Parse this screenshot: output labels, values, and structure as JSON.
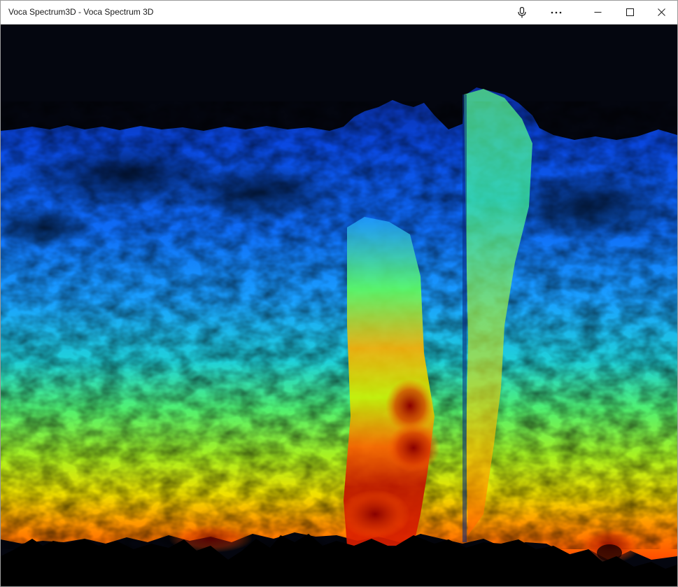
{
  "window": {
    "title": "Voca Spectrum3D - Voca Spectrum 3D"
  },
  "titlebar": {
    "buttons": [
      {
        "name": "microphone",
        "icon": "microphone-icon"
      },
      {
        "name": "more",
        "icon": "more-horizontal-icon"
      },
      {
        "name": "minimize",
        "icon": "minimize-icon"
      },
      {
        "name": "maximize",
        "icon": "maximize-icon"
      },
      {
        "name": "close",
        "icon": "close-icon"
      }
    ]
  },
  "spectrum": {
    "background_color": "#04060f",
    "floor_color": "#000000",
    "colormap": [
      "#001a66",
      "#0050ff",
      "#00aaff",
      "#00e0d0",
      "#60ff40",
      "#d0f000",
      "#ffa000",
      "#ff4000",
      "#a00000"
    ]
  }
}
